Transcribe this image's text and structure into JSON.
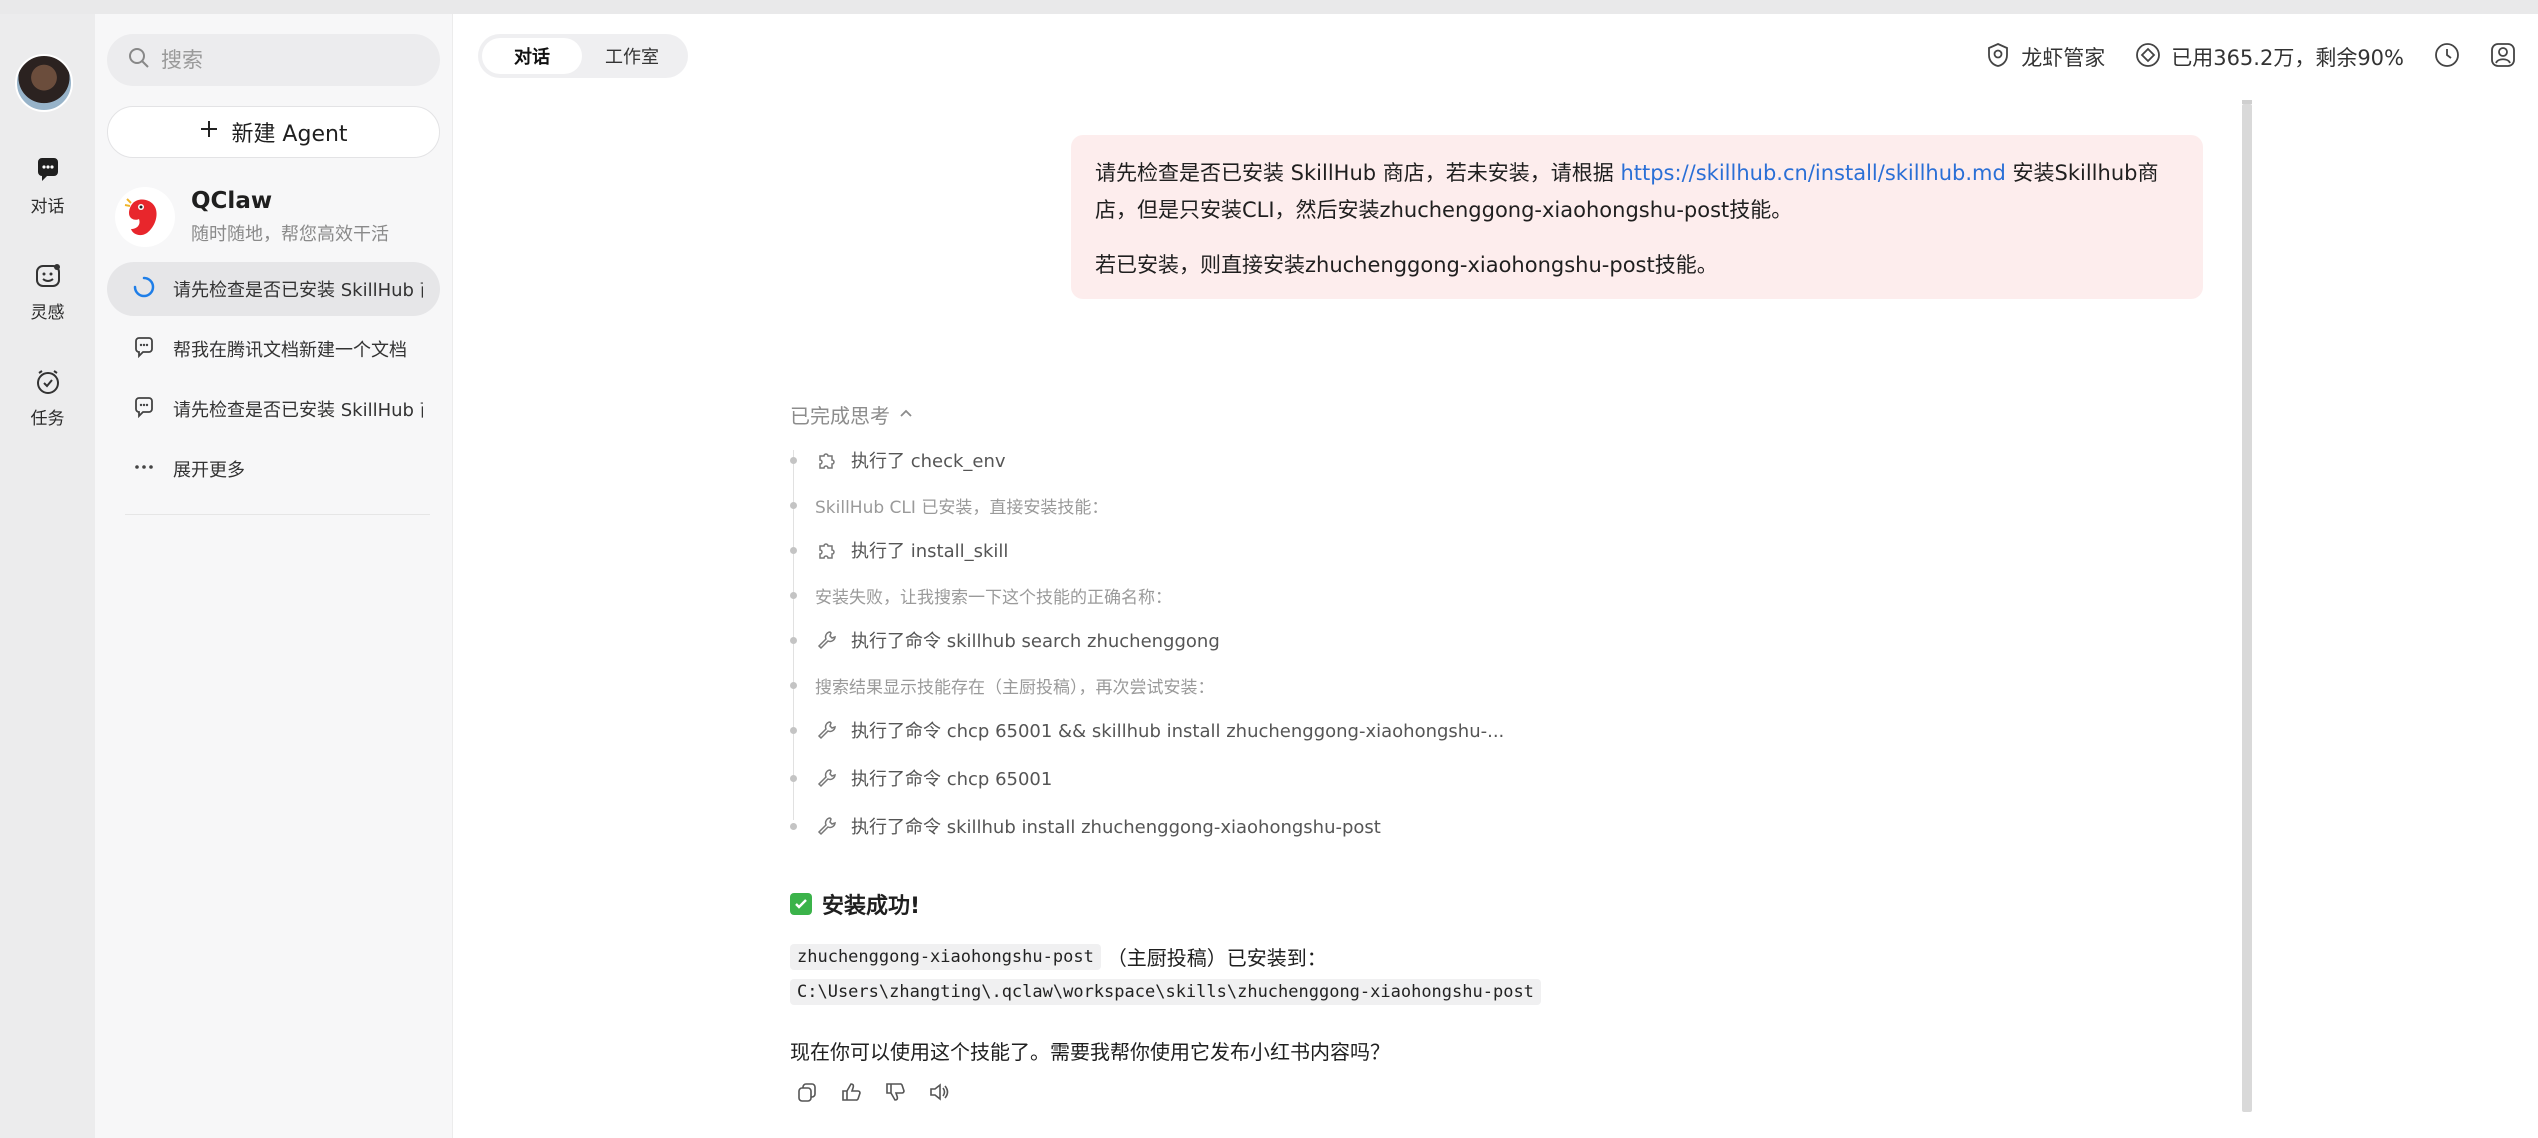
{
  "rail": {
    "items": [
      {
        "label": "对话",
        "icon": "chat-bubble-icon"
      },
      {
        "label": "灵感",
        "icon": "inspiration-face-icon"
      },
      {
        "label": "任务",
        "icon": "alarm-clock-icon"
      }
    ]
  },
  "sidebar": {
    "search_placeholder": "搜索",
    "new_agent_label": "新建 Agent",
    "agent": {
      "name": "QClaw",
      "subtitle": "随时随地，帮您高效干活"
    },
    "conversations": [
      {
        "text": "请先检查是否已安装 SkillHub 商店，若未安装，请根据",
        "status": "loading"
      },
      {
        "text": "帮我在腾讯文档新建一个文档",
        "status": "idle"
      },
      {
        "text": "请先检查是否已安装 SkillHub 商店，若未安装，请根据",
        "status": "idle"
      }
    ],
    "more_label": "展开更多"
  },
  "header": {
    "tabs": [
      {
        "label": "对话",
        "active": true
      },
      {
        "label": "工作室",
        "active": false
      }
    ],
    "manager_label": "龙虾管家",
    "usage_label": "已用365.2万，剩余90%"
  },
  "user_message": {
    "p1_before": "请先检查是否已安装 SkillHub 商店，若未安装，请根据 ",
    "link": "https://skillhub.cn/install/skillhub.md",
    "p1_after": " 安装Skillhub商店，但是只安装CLI，然后安装zhuchenggong-xiaohongshu-post技能。",
    "p2": "若已安装，则直接安装zhuchenggong-xiaohongshu-post技能。"
  },
  "thinking": {
    "header": "已完成思考",
    "steps": [
      {
        "type": "tool",
        "text": "执行了 check_env"
      },
      {
        "type": "note",
        "text": "SkillHub CLI 已安装，直接安装技能："
      },
      {
        "type": "tool",
        "text": "执行了 install_skill"
      },
      {
        "type": "note",
        "text": "安装失败，让我搜索一下这个技能的正确名称："
      },
      {
        "type": "cmd",
        "text": "执行了命令 skillhub search zhuchenggong"
      },
      {
        "type": "note",
        "text": "搜索结果显示技能存在（主厨投稿），再次尝试安装："
      },
      {
        "type": "cmd",
        "text": "执行了命令 chcp 65001 && skillhub install zhuchenggong-xiaohongshu-..."
      },
      {
        "type": "cmd",
        "text": "执行了命令 chcp 65001"
      },
      {
        "type": "cmd",
        "text": "执行了命令 skillhub install zhuchenggong-xiaohongshu-post"
      }
    ]
  },
  "answer": {
    "title": "安装成功!",
    "skill_code": "zhuchenggong-xiaohongshu-post",
    "installed_text": "（主厨投稿）已安装到：",
    "path_code": "C:\\Users\\zhangting\\.qclaw\\workspace\\skills\\zhuchenggong-xiaohongshu-post",
    "followup": "现在你可以使用这个技能了。需要我帮你使用它发布小红书内容吗？"
  },
  "colors": {
    "accent": "#2a6fd6",
    "bubble": "#fdeded",
    "success": "#3bb34a"
  }
}
